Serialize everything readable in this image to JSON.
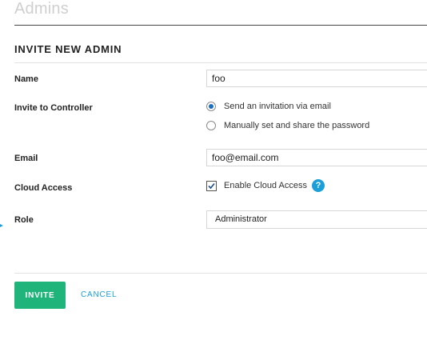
{
  "page": {
    "title": "Admins"
  },
  "form": {
    "section_title": "INVITE NEW ADMIN",
    "name": {
      "label": "Name",
      "value": "foo"
    },
    "invite_to_controller": {
      "label": "Invite to Controller",
      "options": [
        {
          "label": "Send an invitation via email",
          "selected": true
        },
        {
          "label": "Manually set and share the password",
          "selected": false
        }
      ]
    },
    "email": {
      "label": "Email",
      "value": "foo@email.com"
    },
    "cloud_access": {
      "label": "Cloud Access",
      "checkbox_label": "Enable Cloud Access",
      "checked": true,
      "help_icon": "?"
    },
    "role": {
      "label": "Role",
      "value": "Administrator"
    }
  },
  "actions": {
    "invite_label": "INVITE",
    "cancel_label": "CANCEL"
  },
  "colors": {
    "primary_button": "#1fb57a",
    "link": "#1a9fd9",
    "radio_selected": "#1a6fc3"
  }
}
